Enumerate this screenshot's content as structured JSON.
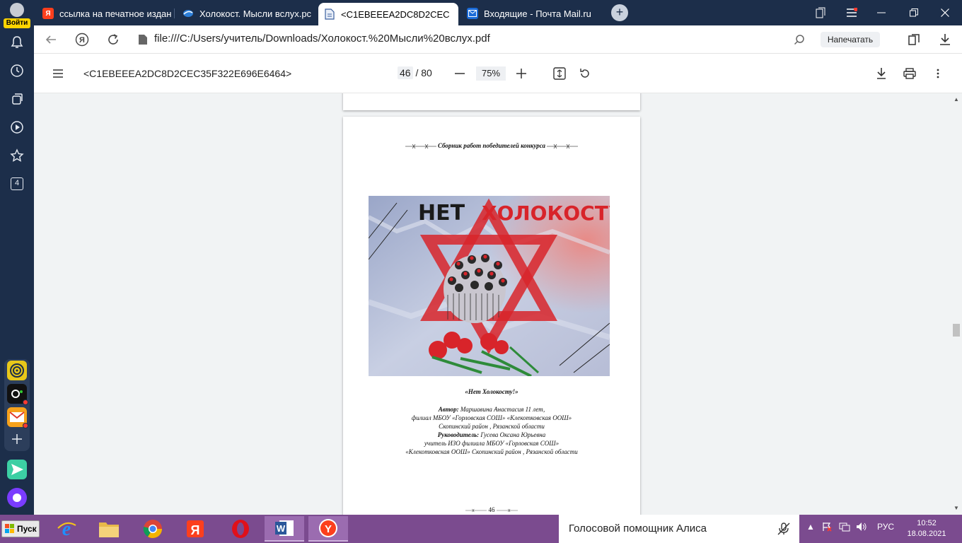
{
  "sidebar": {
    "login_label": "Войти",
    "counter_badge": "4"
  },
  "tabs": [
    {
      "title": "ссылка на печатное издан",
      "favicon": "yandex-icon",
      "favicon_text": "Я"
    },
    {
      "title": "Холокост. Мысли вслух.pc",
      "favicon": "blue-wave-icon"
    },
    {
      "title": "<C1EBEEEA2DC8D2CEC",
      "favicon": "document-icon"
    },
    {
      "title": "Входящие - Почта Mail.ru",
      "favicon": "mail-icon"
    }
  ],
  "address_bar": {
    "url": "file:///C:/Users/учитель/Downloads/Холокост.%20Мысли%20вслух.pdf",
    "print_label": "Напечатать"
  },
  "pdf_toolbar": {
    "title": "<C1EBEEEA2DC8D2CEC35F322E696E6464>",
    "current_page": "46",
    "total_pages": "/ 80",
    "zoom": "75%"
  },
  "document": {
    "header": "Сборник работ победителей конкурса",
    "poster_text_1": "НЕТ",
    "poster_text_2": "ХОЛОКОСТУ!",
    "caption": "«Нет Холокосту!»",
    "author_label": "Автор:",
    "author_value": "Маршавина Анастасия 11 лет,",
    "line2": "филиал МБОУ «Горловская СОШ» «Клекотковская ООШ»",
    "line3": "Скопинский район , Рязанской области",
    "supervisor_label": "Руководитель:",
    "supervisor_value": "Гусева Оксана Юрьевна",
    "line5": "учитель ИЗО филиала МБОУ «Горловская СОШ»",
    "line6": "«Клекотковская ООШ» Скопинский район , Рязанской области",
    "page_number": "46"
  },
  "taskbar": {
    "start_label": "Пуск",
    "alice_label": "Голосовой помощник Алиса",
    "language": "РУС",
    "time": "10:52",
    "date": "18.08.2021"
  },
  "colors": {
    "sidebar_bg": "#1c2e4a",
    "taskbar_bg": "#7b4b8f",
    "viewer_bg": "#f1f3f4",
    "poster_red": "#d8242a"
  }
}
